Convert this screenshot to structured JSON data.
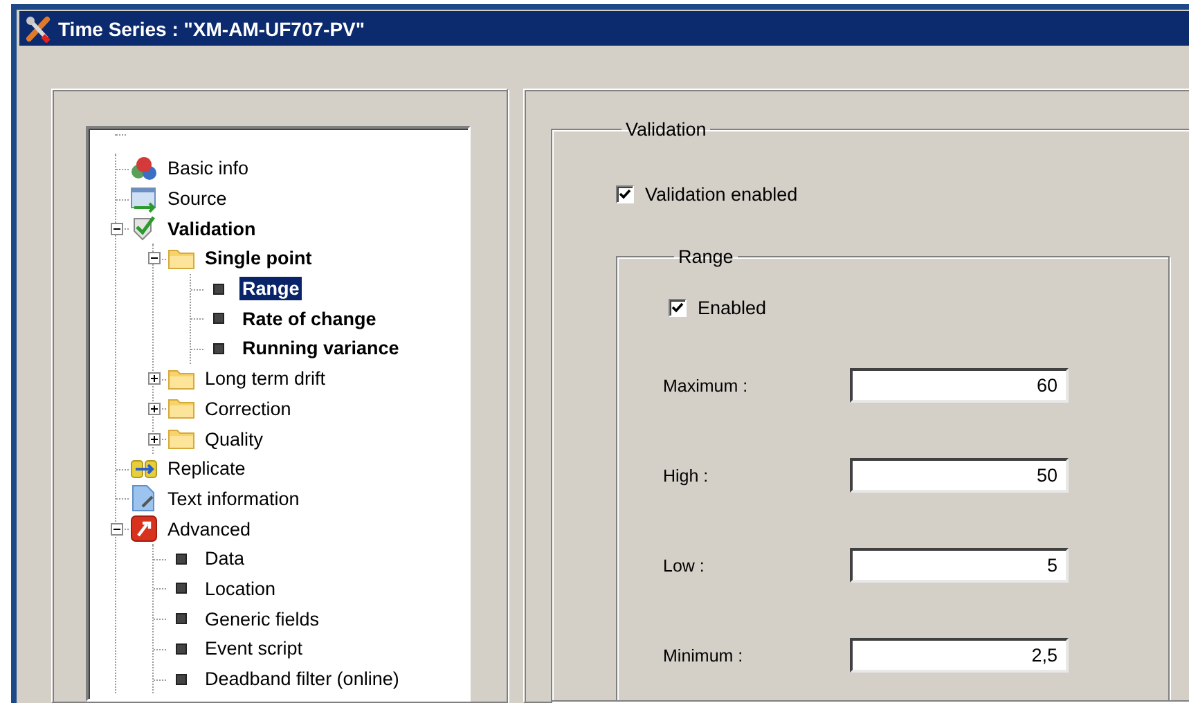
{
  "window": {
    "title": "Time Series : \"XM-AM-UF707-PV\""
  },
  "tree": [
    {
      "label": "Basic info",
      "kind": "info",
      "bold": false,
      "selected": false
    },
    {
      "label": "Source",
      "kind": "source",
      "bold": false,
      "selected": false
    },
    {
      "label": "Validation",
      "kind": "validation",
      "bold": true,
      "selected": false,
      "expanded": true,
      "children": [
        {
          "label": "Single point",
          "kind": "folder",
          "bold": true,
          "selected": false,
          "expanded": true,
          "children": [
            {
              "label": "Range",
              "kind": "leaf",
              "bold": true,
              "selected": true
            },
            {
              "label": "Rate of change",
              "kind": "leaf",
              "bold": true,
              "selected": false
            },
            {
              "label": "Running variance",
              "kind": "leaf",
              "bold": true,
              "selected": false
            }
          ]
        },
        {
          "label": "Long term drift",
          "kind": "folder",
          "bold": false,
          "selected": false,
          "expanded": false
        },
        {
          "label": "Correction",
          "kind": "folder",
          "bold": false,
          "selected": false,
          "expanded": false
        },
        {
          "label": "Quality",
          "kind": "folder",
          "bold": false,
          "selected": false,
          "expanded": false
        }
      ]
    },
    {
      "label": "Replicate",
      "kind": "replicate",
      "bold": false,
      "selected": false
    },
    {
      "label": "Text information",
      "kind": "text",
      "bold": false,
      "selected": false
    },
    {
      "label": "Advanced",
      "kind": "advanced",
      "bold": false,
      "selected": false,
      "expanded": true,
      "children": [
        {
          "label": "Data",
          "kind": "leaf",
          "bold": false,
          "selected": false
        },
        {
          "label": "Location",
          "kind": "leaf",
          "bold": false,
          "selected": false
        },
        {
          "label": "Generic fields",
          "kind": "leaf",
          "bold": false,
          "selected": false
        },
        {
          "label": "Event script",
          "kind": "leaf",
          "bold": false,
          "selected": false
        },
        {
          "label": "Deadband filter (online)",
          "kind": "leaf",
          "bold": false,
          "selected": false
        }
      ]
    }
  ],
  "validation": {
    "title": "Validation",
    "enabled": {
      "label": "Validation enabled",
      "checked": true
    },
    "range": {
      "title": "Range",
      "enabled": {
        "label": "Enabled",
        "checked": true
      },
      "fields": [
        {
          "label": "Maximum :",
          "value": "60"
        },
        {
          "label": "High :",
          "value": "50"
        },
        {
          "label": "Low :",
          "value": "5"
        },
        {
          "label": "Minimum :",
          "value": "2,5"
        }
      ]
    }
  }
}
